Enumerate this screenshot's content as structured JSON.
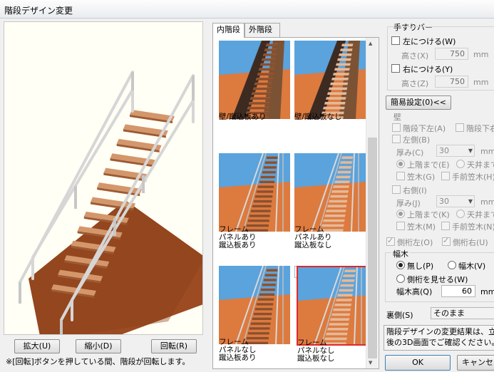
{
  "window": {
    "title": "階段デザイン変更"
  },
  "preview": {
    "zoom_in": "拡大(U)",
    "zoom_out": "縮小(D)",
    "rotate": "回転(R)",
    "note": "※[回転]ボタンを押している間、階段が回転します。"
  },
  "tabs": [
    {
      "label": "内階段",
      "active": true
    },
    {
      "label": "外階段",
      "active": false
    }
  ],
  "thumbnails": [
    {
      "caption": "壁/蹴込板あり",
      "frame": false,
      "riser": true,
      "selected": false
    },
    {
      "caption": "壁/蹴込板なし",
      "frame": false,
      "riser": false,
      "selected": false
    },
    {
      "caption": "フレーム\nパネルあり\n蹴込板あり",
      "frame": true,
      "riser": true,
      "selected": false
    },
    {
      "caption": "フレーム\nパネルあり\n蹴込板なし",
      "frame": true,
      "riser": false,
      "selected": false
    },
    {
      "caption": "フレーム\nパネルなし\n蹴込板あり",
      "frame": true,
      "riser": true,
      "selected": false
    },
    {
      "caption": "フレーム\nパネルなし\n蹴込板なし",
      "frame": true,
      "riser": false,
      "selected": true
    }
  ],
  "handrail": {
    "title": "手すりバー",
    "left_label": "左につける(W)",
    "left_height_label": "高さ(X)",
    "left_height_value": "750",
    "right_label": "右につける(Y)",
    "right_height_label": "高さ(Z)",
    "right_height_value": "750",
    "unit": "mm"
  },
  "simple_settings": "簡易設定(0)<<",
  "wall": {
    "title": "壁",
    "below_left": "階段下左(A)",
    "below_right": "階段下右",
    "left_side": "左側(B)",
    "left_thickness_label": "厚み(C)",
    "left_thickness_value": "30",
    "left_to_upper": "上階まで(E)",
    "left_to_ceiling": "天井まで",
    "left_baseboard": "笠木(G)",
    "left_front_baseboard": "手前笠木(H)",
    "right_side": "右側(I)",
    "right_thickness_label": "厚み(J)",
    "right_thickness_value": "30",
    "right_to_upper": "上階まで(K)",
    "right_to_ceiling": "天井まで",
    "right_baseboard": "笠木(M)",
    "right_front_baseboard": "手前笠木(N)",
    "unit": "mm"
  },
  "stringer": {
    "left": "側桁左(O)",
    "right": "側桁右(U)"
  },
  "skirting": {
    "title": "幅木",
    "none": "無し(P)",
    "skirting": "幅木(V)",
    "show_stringer": "側桁を見せる(W)",
    "height_label": "幅木高(Q)",
    "height_value": "60",
    "unit": "mm"
  },
  "back_side": {
    "label": "裏側(S)",
    "value": "そのまま"
  },
  "description": {
    "line1": "階段デザインの変更結果は、立",
    "line2": "後の3D画面でご確認ください。"
  },
  "buttons": {
    "ok": "OK",
    "cancel": "キャンセル"
  },
  "colors": {
    "wood": "#c07a4a",
    "floor": "#9c4b22",
    "rail": "#d6d6d6",
    "selection": "#e0282c",
    "sky": "#5aa3dd"
  }
}
